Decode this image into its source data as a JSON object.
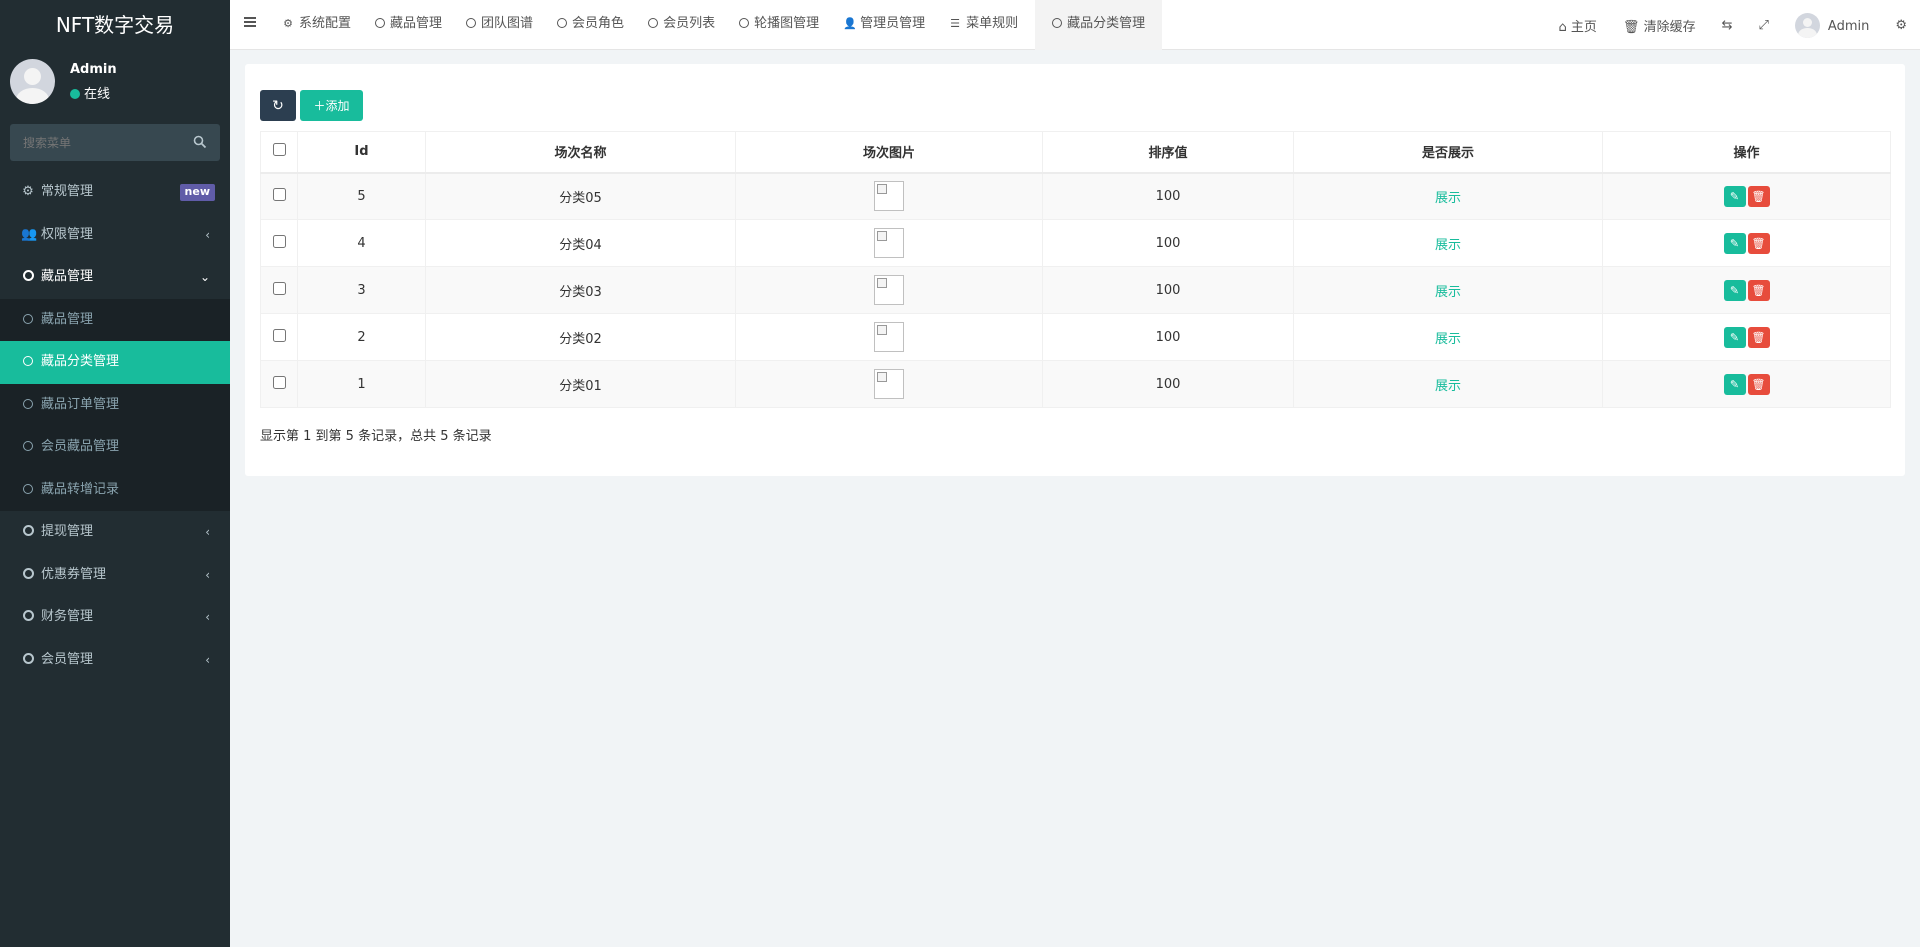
{
  "app": {
    "brand": "NFT数字交易"
  },
  "user": {
    "name": "Admin",
    "status": "在线"
  },
  "search": {
    "placeholder": "搜索菜单"
  },
  "menu": {
    "items": [
      {
        "label": "常规管理",
        "badge": "new"
      },
      {
        "label": "权限管理"
      },
      {
        "label": "藏品管理"
      },
      {
        "label": "提现管理"
      },
      {
        "label": "优惠券管理"
      },
      {
        "label": "财务管理"
      },
      {
        "label": "会员管理"
      }
    ],
    "sub": [
      "藏品管理",
      "藏品分类管理",
      "藏品订单管理",
      "会员藏品管理",
      "藏品转增记录"
    ]
  },
  "tabs": [
    "系统配置",
    "藏品管理",
    "团队图谱",
    "会员角色",
    "会员列表",
    "轮播图管理",
    "管理员管理",
    "菜单规则",
    "藏品分类管理"
  ],
  "navRight": {
    "home": "主页",
    "clear": "清除缓存",
    "admin": "Admin"
  },
  "toolbar": {
    "add": "添加"
  },
  "table": {
    "headers": [
      "Id",
      "场次名称",
      "场次图片",
      "排序值",
      "是否展示",
      "操作"
    ],
    "rows": [
      {
        "id": "5",
        "name": "分类05",
        "sort": "100",
        "show": "展示"
      },
      {
        "id": "4",
        "name": "分类04",
        "sort": "100",
        "show": "展示"
      },
      {
        "id": "3",
        "name": "分类03",
        "sort": "100",
        "show": "展示"
      },
      {
        "id": "2",
        "name": "分类02",
        "sort": "100",
        "show": "展示"
      },
      {
        "id": "1",
        "name": "分类01",
        "sort": "100",
        "show": "展示"
      }
    ]
  },
  "summary": "显示第 1 到第 5 条记录，总共 5 条记录",
  "colors": {
    "primary": "#18bc9c",
    "danger": "#e74c3c",
    "sidebar": "#222d32",
    "dark": "#2c3e50"
  }
}
